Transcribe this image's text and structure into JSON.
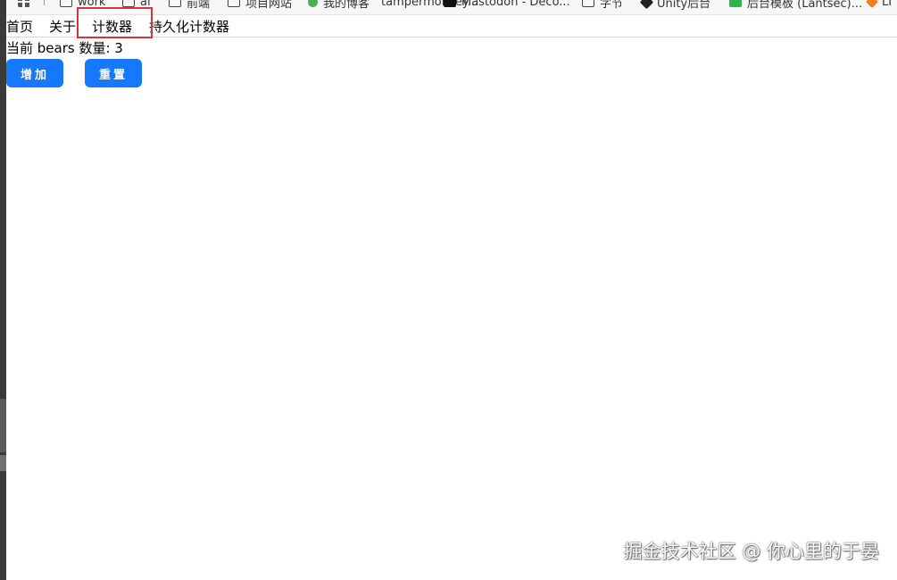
{
  "bookmarks_bar": {
    "items": [
      {
        "label": "",
        "icon": "apps-grid-icon"
      },
      {
        "label": "work",
        "icon": "folder-icon"
      },
      {
        "label": "ai",
        "icon": "folder-icon"
      },
      {
        "label": "前端",
        "icon": "folder-icon"
      },
      {
        "label": "项目网站",
        "icon": "folder-icon"
      },
      {
        "label": "我的博客",
        "icon": "site-icon"
      },
      {
        "label": "tampermonkey...",
        "icon": "site-icon"
      },
      {
        "label": "Mastodon - Deco...",
        "icon": "site-icon"
      },
      {
        "label": "字节",
        "icon": "folder-icon"
      },
      {
        "label": "Unity后台",
        "icon": "site-icon"
      },
      {
        "label": "后台模板 (Lantsec)...",
        "icon": "site-icon"
      },
      {
        "label": "LI",
        "icon": "site-icon"
      }
    ]
  },
  "nav": {
    "links": [
      "首页",
      "关于",
      "计数器",
      "持久化计数器"
    ],
    "active_index": 2,
    "highlight_color": "#d4343a"
  },
  "counter": {
    "label": "当前 bears 数量: 3"
  },
  "buttons": {
    "increase": "增加",
    "reset": "重置",
    "color": "#1677ff"
  },
  "watermark": "掘金技术社区 @ 你心里的于晏"
}
